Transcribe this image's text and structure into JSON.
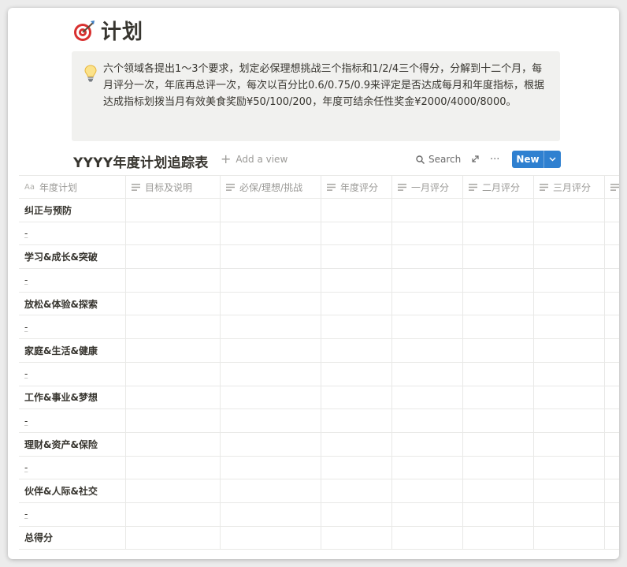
{
  "page": {
    "title": "计划",
    "emoji": "target-icon"
  },
  "callout": {
    "icon": "lightbulb-icon",
    "text": "六个领域各提出1～3个要求，划定必保理想挑战三个指标和1/2/4三个得分，分解到十二个月，每月评分一次，年底再总评一次，每次以百分比0.6/0.75/0.9来评定是否达成每月和年度指标，根据达成指标划拨当月有效美食奖励¥50/100/200，年度可结余任性奖金¥2000/4000/8000。"
  },
  "database": {
    "title": "YYYY年度计划追踪表",
    "add_view_label": "Add a view",
    "search_label": "Search",
    "more_label": "···",
    "new_label": "New",
    "columns": [
      "年度计划",
      "目标及说明",
      "必保/理想/挑战",
      "年度评分",
      "一月评分",
      "二月评分",
      "三月评分",
      ""
    ],
    "rows": [
      {
        "name": "纠正与预防",
        "kind": "category"
      },
      {
        "name": "-",
        "kind": "item"
      },
      {
        "name": "学习&成长&突破",
        "kind": "category"
      },
      {
        "name": "-",
        "kind": "item"
      },
      {
        "name": "放松&体验&探索",
        "kind": "category"
      },
      {
        "name": "-",
        "kind": "item"
      },
      {
        "name": "家庭&生活&健康",
        "kind": "category"
      },
      {
        "name": "-",
        "kind": "item"
      },
      {
        "name": "工作&事业&梦想",
        "kind": "category"
      },
      {
        "name": "-",
        "kind": "item"
      },
      {
        "name": "理财&资产&保险",
        "kind": "category"
      },
      {
        "name": "-",
        "kind": "item"
      },
      {
        "name": "伙伴&人际&社交",
        "kind": "category"
      },
      {
        "name": "-",
        "kind": "item"
      },
      {
        "name": "总得分",
        "kind": "category"
      }
    ]
  },
  "colors": {
    "accent": "#2f80d0",
    "text": "#37352f",
    "muted": "#9b9a97",
    "callout_bg": "#f1f1ef",
    "border": "#e9e9e7"
  }
}
